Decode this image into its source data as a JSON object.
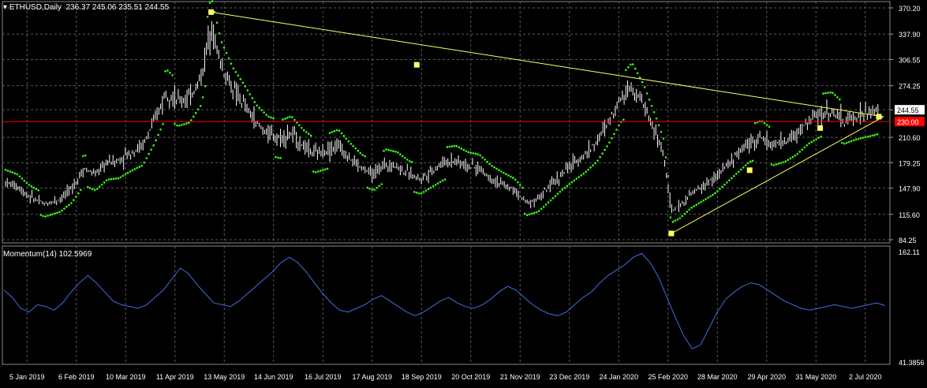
{
  "window": {
    "symbol_timeframe": "ETHUSD,Daily",
    "ohlc": "236.37 245.06 235.51 244.55",
    "indicator_label": "Momentum(14) 102.5969"
  },
  "colors": {
    "background": "#000000",
    "candles": "#ffffff",
    "grid": "#5a5a5a",
    "sar": "#39ff14",
    "trendline": "#ffff66",
    "hline": "#ff0000",
    "momentum": "#3f6fe0",
    "current_price_tag_bg": "#ffffff",
    "hline_tag_bg": "#ff0000"
  },
  "chart_data": [
    {
      "type": "candlestick",
      "title": "ETHUSD,Daily",
      "y_ticks": [
        "370.20",
        "337.90",
        "306.55",
        "274.25",
        "244.55",
        "210.60",
        "179.25",
        "147.90",
        "115.60",
        "84.25"
      ],
      "y_tick_values": [
        370.2,
        337.9,
        306.55,
        274.25,
        244.55,
        210.6,
        179.25,
        147.9,
        115.6,
        84.25
      ],
      "ylim": [
        84.25,
        370.2
      ],
      "current_price": "244.55",
      "horizontal_line": "230.00",
      "x_ticks": [
        "5 Jan 2019",
        "6 Feb 2019",
        "10 Mar 2019",
        "11 Apr 2019",
        "13 May 2019",
        "14 Jun 2019",
        "16 Jul 2019",
        "17 Aug 2019",
        "18 Sep 2019",
        "20 Oct 2019",
        "21 Nov 2019",
        "23 Dec 2019",
        "24 Jan 2020",
        "25 Feb 2020",
        "28 Mar 2020",
        "29 Apr 2020",
        "31 May 2020",
        "2 Jul 2020"
      ],
      "price_path": [
        [
          0,
          155
        ],
        [
          6,
          150
        ],
        [
          12,
          138
        ],
        [
          20,
          128
        ],
        [
          28,
          135
        ],
        [
          34,
          148
        ],
        [
          40,
          172
        ],
        [
          46,
          165
        ],
        [
          52,
          180
        ],
        [
          58,
          182
        ],
        [
          64,
          192
        ],
        [
          70,
          200
        ],
        [
          76,
          230
        ],
        [
          82,
          268
        ],
        [
          88,
          255
        ],
        [
          94,
          260
        ],
        [
          100,
          285
        ],
        [
          105,
          350
        ],
        [
          110,
          300
        ],
        [
          116,
          270
        ],
        [
          122,
          250
        ],
        [
          128,
          228
        ],
        [
          134,
          215
        ],
        [
          140,
          210
        ],
        [
          146,
          215
        ],
        [
          152,
          200
        ],
        [
          158,
          190
        ],
        [
          164,
          195
        ],
        [
          170,
          200
        ],
        [
          176,
          185
        ],
        [
          182,
          172
        ],
        [
          188,
          165
        ],
        [
          194,
          178
        ],
        [
          200,
          175
        ],
        [
          206,
          165
        ],
        [
          212,
          160
        ],
        [
          218,
          170
        ],
        [
          224,
          180
        ],
        [
          230,
          182
        ],
        [
          236,
          175
        ],
        [
          242,
          172
        ],
        [
          248,
          160
        ],
        [
          254,
          152
        ],
        [
          260,
          145
        ],
        [
          266,
          130
        ],
        [
          272,
          135
        ],
        [
          278,
          150
        ],
        [
          284,
          165
        ],
        [
          290,
          178
        ],
        [
          296,
          190
        ],
        [
          302,
          205
        ],
        [
          308,
          230
        ],
        [
          314,
          260
        ],
        [
          320,
          275
        ],
        [
          326,
          250
        ],
        [
          332,
          215
        ],
        [
          336,
          190
        ],
        [
          340,
          120
        ],
        [
          344,
          125
        ],
        [
          350,
          140
        ],
        [
          356,
          150
        ],
        [
          362,
          160
        ],
        [
          368,
          175
        ],
        [
          374,
          190
        ],
        [
          380,
          205
        ],
        [
          386,
          210
        ],
        [
          392,
          200
        ],
        [
          398,
          205
        ],
        [
          404,
          215
        ],
        [
          410,
          230
        ],
        [
          416,
          240
        ],
        [
          422,
          242
        ],
        [
          428,
          230
        ],
        [
          434,
          236
        ],
        [
          440,
          240
        ],
        [
          446,
          244
        ]
      ],
      "sar_dots": "parabolic SAR dots above price in downtrends, below price in uptrends",
      "trendlines": [
        {
          "from": [
            "14 Jun 2019",
            365
          ],
          "to": [
            "2 Jul 2020",
            236
          ]
        },
        {
          "from": [
            "mid Mar 2020",
            90
          ],
          "to": [
            "2 Jul 2020",
            236
          ]
        }
      ]
    },
    {
      "type": "line",
      "title": "Momentum(14) 102.5969",
      "y_ticks": [
        "162.11",
        "41.3856"
      ],
      "y_tick_values": [
        162.11,
        41.3856
      ],
      "ylim": [
        41.3856,
        162.11
      ],
      "values": [
        120,
        112,
        100,
        96,
        104,
        102,
        98,
        106,
        118,
        128,
        136,
        128,
        118,
        108,
        104,
        102,
        100,
        104,
        112,
        120,
        132,
        144,
        138,
        126,
        116,
        106,
        104,
        102,
        108,
        116,
        124,
        132,
        140,
        150,
        156,
        150,
        140,
        128,
        116,
        106,
        98,
        96,
        100,
        104,
        110,
        114,
        108,
        102,
        96,
        92,
        96,
        102,
        108,
        112,
        106,
        102,
        100,
        104,
        110,
        118,
        124,
        120,
        112,
        104,
        98,
        94,
        92,
        96,
        104,
        112,
        118,
        128,
        136,
        142,
        148,
        156,
        160,
        150,
        134,
        112,
        90,
        70,
        56,
        60,
        78,
        96,
        110,
        118,
        124,
        128,
        126,
        120,
        114,
        108,
        104,
        100,
        98,
        100,
        102,
        104,
        102,
        100,
        102,
        104,
        106,
        103
      ]
    }
  ]
}
